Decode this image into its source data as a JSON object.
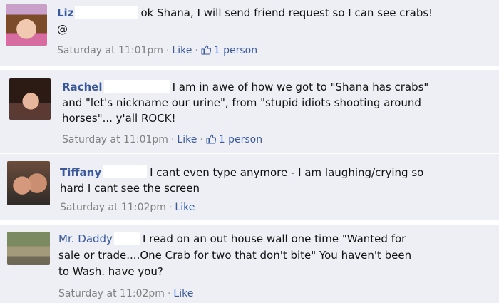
{
  "comments": [
    {
      "author": "Liz",
      "lines": [
        "ok Shana, I will send friend request so I can see crabs!",
        "@"
      ],
      "time": "Saturday at 11:01pm",
      "like_label": "Like",
      "likes_label": "1 person",
      "icons": [
        "avatar-photo",
        "thumbs-up-icon"
      ]
    },
    {
      "author": "Rachel",
      "lines": [
        "I am in awe of how we got to \"Shana has crabs\"",
        "and \"let's nickname our urine\", from \"stupid idiots shooting around",
        "horses\"... y'all ROCK!"
      ],
      "time": "Saturday at 11:01pm",
      "like_label": "Like",
      "likes_label": "1 person",
      "icons": [
        "avatar-photo",
        "thumbs-up-icon"
      ]
    },
    {
      "author": "Tiffany",
      "lines": [
        "I cant even type anymore - I am laughing/crying so",
        "hard I cant see the screen"
      ],
      "time": "Saturday at 11:02pm",
      "like_label": "Like",
      "icons": [
        "avatar-photo"
      ]
    },
    {
      "author": "Mr. Daddy",
      "lines": [
        "I read on an out house wall one time \"Wanted for",
        "sale or trade....One Crab for two that don't bite\" You haven't been",
        "to Wash. have you?"
      ],
      "time": "Saturday at 11:02pm",
      "like_label": "Like",
      "icons": [
        "avatar-photo"
      ]
    }
  ],
  "colors": {
    "comment_bg": "#edeff4",
    "link": "#3b5998",
    "meta_text": "#808080",
    "text": "#111111"
  }
}
